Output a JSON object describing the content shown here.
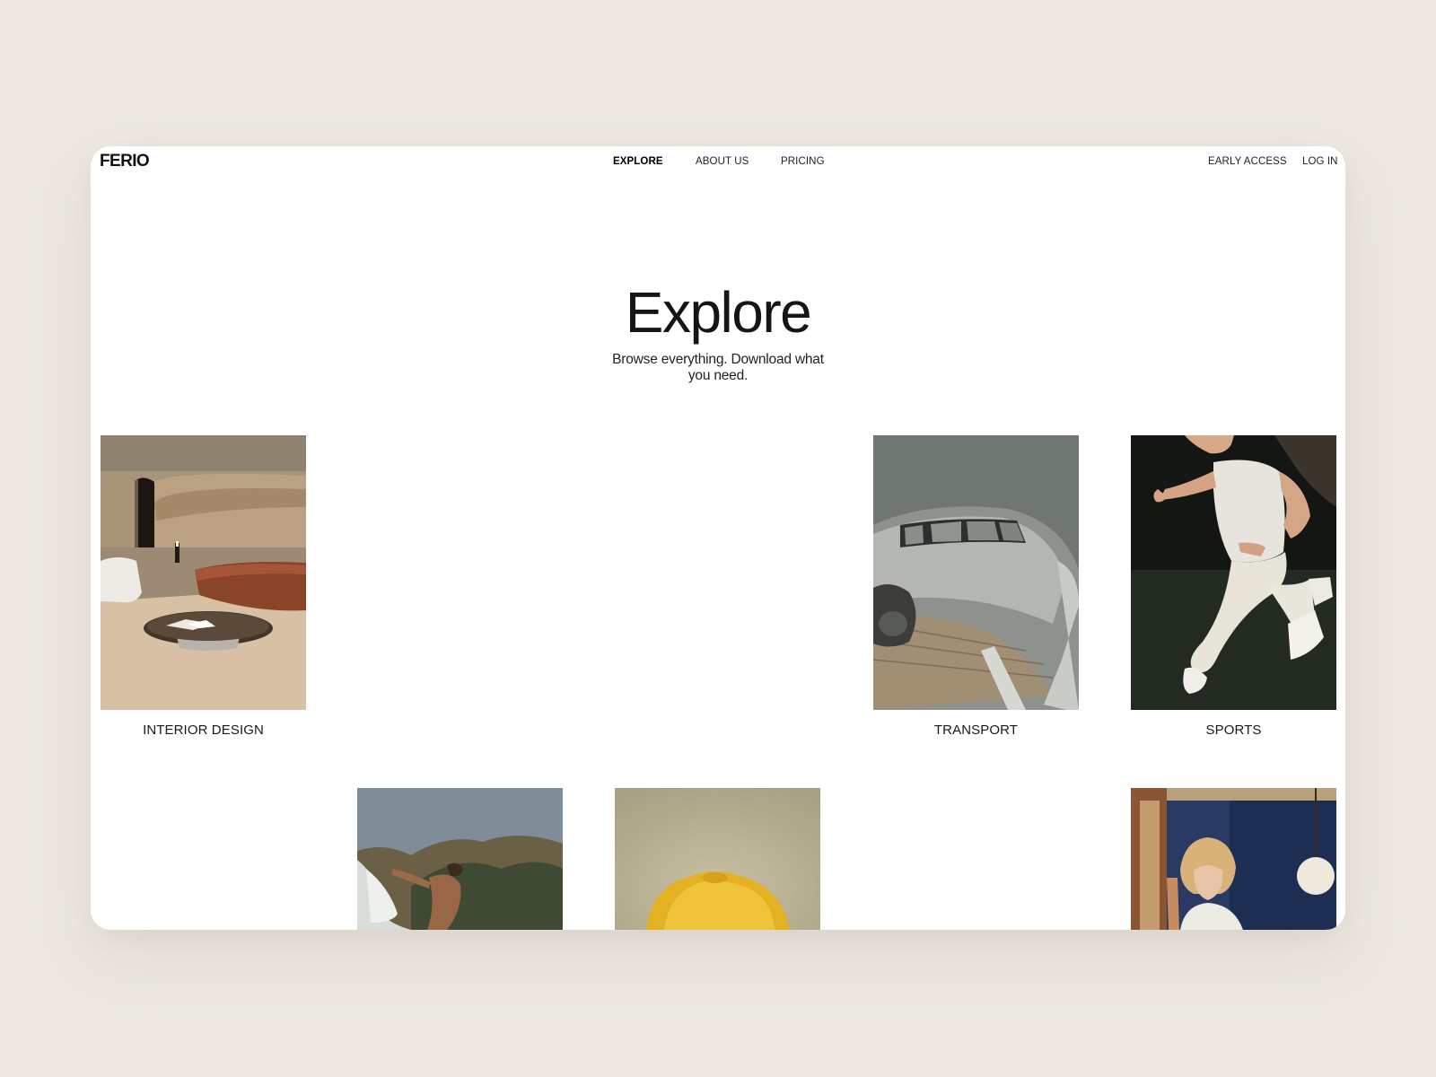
{
  "brand": {
    "logo": "FERIO"
  },
  "nav": {
    "center": [
      "EXPLORE",
      "ABOUT US",
      "PRICING"
    ],
    "right": [
      "EARLY ACCESS",
      "LOG IN"
    ],
    "active": "EXPLORE"
  },
  "hero": {
    "title": "Explore",
    "subtitle": "Browse everything. Download what you need."
  },
  "categories": {
    "row1": [
      "INTERIOR DESIGN",
      "TRANSPORT",
      "SPORTS"
    ]
  },
  "colors": {
    "background": "#ede8e2",
    "surface": "#ffffff",
    "text": "#111111"
  }
}
